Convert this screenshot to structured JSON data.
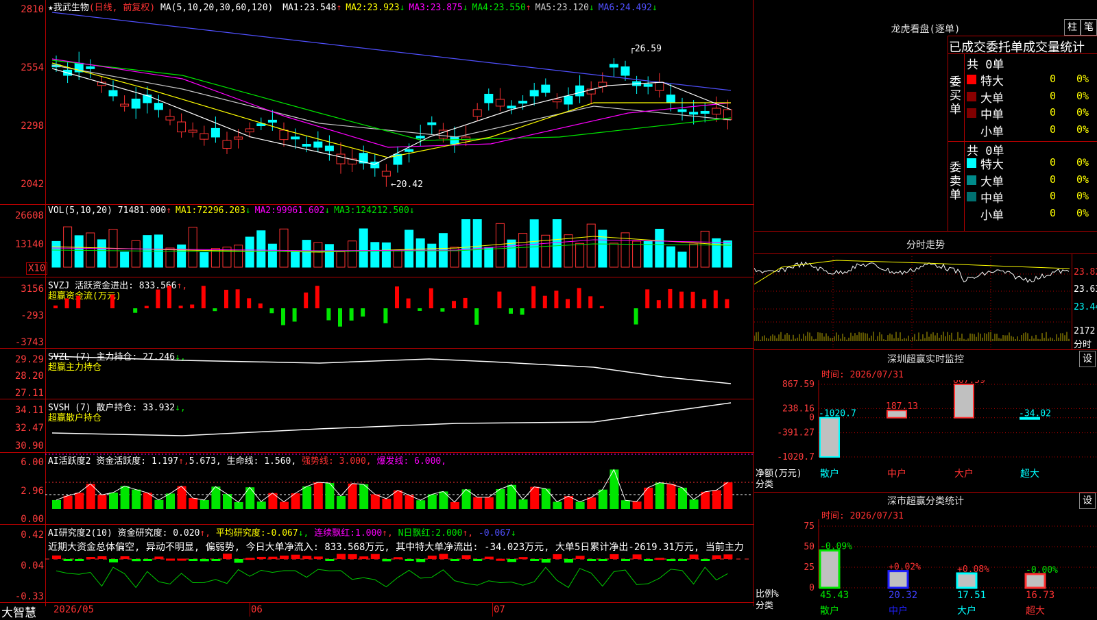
{
  "main": {
    "star": "★",
    "stock_name": "我武生物",
    "mode": "(日线, 前复权)",
    "ma_header": "MA(5,10,20,30,60,120)",
    "ma": [
      {
        "label": "MA1:",
        "value": "23.548",
        "arrow": "↑",
        "color": "#ffffff"
      },
      {
        "label": "MA2:",
        "value": "23.923",
        "arrow": "↓",
        "color": "#ffff00"
      },
      {
        "label": "MA3:",
        "value": "23.875",
        "arrow": "↓",
        "color": "#ff00ff"
      },
      {
        "label": "MA4:",
        "value": "23.550",
        "arrow": "↑",
        "color": "#00e600"
      },
      {
        "label": "MA5:",
        "value": "23.120",
        "arrow": "↓",
        "color": "#c8c8c8"
      },
      {
        "label": "MA6:",
        "value": "24.492",
        "arrow": "↓",
        "color": "#5050ff"
      }
    ],
    "y_ticks": [
      "2810",
      "2554",
      "2298",
      "2042"
    ],
    "high_label": "26.59",
    "low_label": "20.42"
  },
  "vol": {
    "title": "VOL(5,10,20)",
    "value": "71481.000",
    "arrow": "↑",
    "ma": [
      {
        "label": "MA1:",
        "value": "72296.203",
        "arrow": "↓",
        "color": "#ffff00"
      },
      {
        "label": "MA2:",
        "value": "99961.602",
        "arrow": "↓",
        "color": "#ff00ff"
      },
      {
        "label": "MA3:",
        "value": "124212.500",
        "arrow": "↓",
        "color": "#00e600"
      }
    ],
    "y_ticks": [
      "26608",
      "13140"
    ],
    "unit": "X10"
  },
  "svzj": {
    "title": "SVZJ  活跃资金进出:",
    "value": "833.566",
    "arrow": "↑,",
    "subtitle": "超赢资金流(万元)",
    "y_ticks": [
      "3156",
      "-293",
      "-3743"
    ]
  },
  "svzl": {
    "title": "SVZL (7) 主力持仓:",
    "value": "27.246",
    "arrow": "↓,",
    "subtitle": "超赢主力持仓",
    "y_ticks": [
      "29.29",
      "28.20",
      "27.11"
    ]
  },
  "svsh": {
    "title": "SVSH (7) 散户持仓:",
    "value": "33.932",
    "arrow": "↓,",
    "subtitle": "超赢散户持仓",
    "y_ticks": [
      "34.11",
      "32.47",
      "30.90"
    ]
  },
  "ai1": {
    "title": "AI活跃度2 资金活跃度:",
    "v1": "1.197",
    "a1": "↑,",
    "v2": "5.673,",
    "l3": "生命线:",
    "v3": "1.560,",
    "l4": "强势线:",
    "v4": "3.000,",
    "l5": "爆发线:",
    "v5": "6.000,",
    "y_ticks": [
      "6.00",
      "2.96",
      "0.00"
    ]
  },
  "ai2": {
    "title": "AI研究度2(10) 资金研究度:",
    "v1": "0.020",
    "a1": "↑,",
    "l2": "平均研究度:",
    "v2": "-0.067",
    "a2": "↓,",
    "l3": "连续飘红:",
    "v3": "1.000",
    "a3": "↑,",
    "l4": "N日飘红:",
    "v4": "2.000",
    "a4": "↑,",
    "v5": "-0.067",
    "a5": "↓",
    "summary": "近期大资金总体偏空, 异动不明显, 偏弱势, 今日大单净流入: 833.568万元, 其中特大单净流出: -34.023万元, 大单5日累计净出-2619.31万元, 当前主力",
    "y_ticks": [
      "0.42",
      "0.04",
      "-0.33"
    ]
  },
  "bottom": {
    "brand": "大智慧",
    "dates": [
      "2026/05",
      "06",
      "07"
    ]
  },
  "right": {
    "lhb_title": "龙虎看盘(逐单)",
    "btn_zhu": "柱",
    "btn_bi": "笔",
    "stat_title": "已成交委托单成交量统计",
    "buy": {
      "side": "委买单",
      "total": "共 0单",
      "rows": [
        {
          "label": "特大",
          "count": "0",
          "pct": "0%",
          "color": "#ff0000"
        },
        {
          "label": "大单",
          "count": "0",
          "pct": "0%",
          "color": "#8b0000"
        },
        {
          "label": "中单",
          "count": "0",
          "pct": "0%",
          "color": "#800000"
        },
        {
          "label": "小单",
          "count": "0",
          "pct": "0%",
          "color": "#000000"
        }
      ]
    },
    "sell": {
      "side": "委卖单",
      "total": "共 0单",
      "rows": [
        {
          "label": "特大",
          "count": "0",
          "pct": "0%",
          "color": "#00ffff"
        },
        {
          "label": "大单",
          "count": "0",
          "pct": "0%",
          "color": "#008b8b"
        },
        {
          "label": "中单",
          "count": "0",
          "pct": "0%",
          "color": "#007070"
        },
        {
          "label": "小单",
          "count": "0",
          "pct": "0%",
          "color": "#000000"
        }
      ]
    },
    "fenshi": {
      "title": "分时走势",
      "y_ticks": [
        "23.82",
        "23.63",
        "23.44"
      ],
      "vol_tick": "2172",
      "unit": "分时"
    },
    "monitor": {
      "title": "深圳超赢实时监控",
      "btn": "设",
      "time": "时间: 2026/07/31",
      "y_ticks": [
        "867.59",
        "238.16",
        "0",
        "-391.27",
        "-1020.7"
      ],
      "ylabel1": "净额(万元)",
      "ylabel2": "分类",
      "categories": [
        "散户",
        "中户",
        "大户",
        "超大"
      ],
      "values": [
        "-1020.7",
        "187.13",
        "867.59",
        "-34.02"
      ]
    },
    "classify": {
      "title": "深市超赢分类统计",
      "btn": "设",
      "time": "时间: 2026/07/31",
      "y_ticks": [
        "75",
        "50",
        "25",
        "0"
      ],
      "ylabel1": "比例%",
      "ylabel2": "分类",
      "categories": [
        "散户",
        "中户",
        "大户",
        "超大"
      ],
      "changes": [
        "-0.09%",
        "+0.02%",
        "+0.08%",
        "-0.00%"
      ],
      "values": [
        "45.43",
        "20.32",
        "17.51",
        "16.73"
      ]
    }
  },
  "chart_data": [
    {
      "type": "bar",
      "title": "深圳超赢实时监控",
      "ylabel": "净额(万元)",
      "categories": [
        "散户",
        "中户",
        "大户",
        "超大"
      ],
      "values": [
        -1020.7,
        187.13,
        867.59,
        -34.02
      ],
      "ylim": [
        -1020.7,
        867.59
      ]
    },
    {
      "type": "bar",
      "title": "深市超赢分类统计",
      "ylabel": "比例%",
      "categories": [
        "散户",
        "中户",
        "大户",
        "超大"
      ],
      "values": [
        45.43,
        20.32,
        17.51,
        16.73
      ],
      "ylim": [
        0,
        75
      ]
    }
  ]
}
